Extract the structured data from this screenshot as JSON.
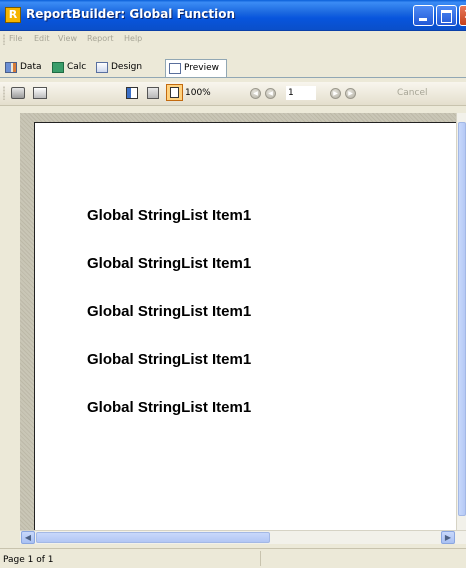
{
  "window": {
    "title": "ReportBuilder: Global Function",
    "app_icon_letter": "R"
  },
  "menu": [
    "File",
    "Edit",
    "View",
    "Report",
    "Help"
  ],
  "tabs": [
    {
      "label": "Data",
      "icon": "data-icon"
    },
    {
      "label": "Calc",
      "icon": "calc-icon"
    },
    {
      "label": "Design",
      "icon": "design-icon"
    },
    {
      "label": "Preview",
      "icon": "preview-icon",
      "active": true
    }
  ],
  "toolbar": {
    "zoom": "100%",
    "page_number": "1",
    "cancel_label": "Cancel",
    "icons": [
      "print-icon",
      "print-setup-icon",
      "whole-page-icon",
      "page-width-icon",
      "hundred-percent-icon",
      "first-page-icon",
      "prior-page-icon",
      "next-page-icon",
      "last-page-icon"
    ]
  },
  "report": {
    "lines": [
      "Global StringList Item1",
      "Global StringList Item1",
      "Global StringList Item1",
      "Global StringList Item1",
      "Global StringList Item1"
    ]
  },
  "status": {
    "page_text": "Page 1 of 1"
  },
  "colors": {
    "titlebar": "#0855dd",
    "chrome": "#ece9d8",
    "page": "#ffffff"
  }
}
